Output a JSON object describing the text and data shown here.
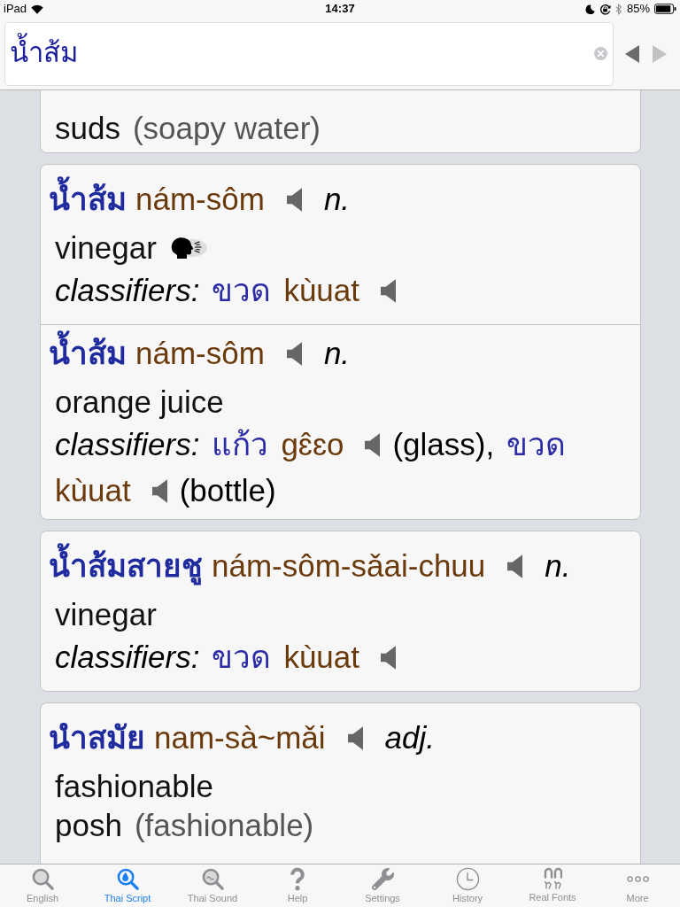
{
  "status_bar": {
    "carrier": "iPad",
    "time": "14:37",
    "battery": "85%"
  },
  "search": {
    "value": "น้ำส้ม",
    "nav": [
      {
        "kind": "back",
        "disabled": false
      },
      {
        "kind": "forward",
        "disabled": true
      }
    ]
  },
  "results": [
    {
      "top_cut": true,
      "bottom_cut": false,
      "entries": [
        {
          "definitions": [
            {
              "text": "suds",
              "note": "(soapy water)",
              "voice": false
            }
          ]
        }
      ]
    },
    {
      "top_cut": false,
      "bottom_cut": false,
      "entries": [
        {
          "thai": "น้ำส้ม",
          "roman": "nám-sôm",
          "pos": "n.",
          "definitions": [
            {
              "text": "vinegar",
              "voice": true
            }
          ],
          "classifier_label": "classifiers:",
          "classifiers": [
            {
              "thai": "ขวด",
              "roman": "kùuat"
            }
          ]
        },
        {
          "thai": "น้ำส้ม",
          "roman": "nám-sôm",
          "pos": "n.",
          "definitions": [
            {
              "text": "orange juice",
              "voice": false
            }
          ],
          "classifier_label": "classifiers:",
          "classifiers": [
            {
              "thai": "แก้ว",
              "roman": "gɛ̂ɛo",
              "note": "(glass),"
            },
            {
              "thai": "ขวด",
              "roman": "kùuat",
              "note": "(bottle)"
            }
          ]
        }
      ]
    },
    {
      "top_cut": false,
      "bottom_cut": false,
      "entries": [
        {
          "thai": "น้ำส้มสายชู",
          "roman": "nám-sôm-sǎai-chuu",
          "pos": "n.",
          "definitions": [
            {
              "text": "vinegar",
              "voice": false
            }
          ],
          "classifier_label": "classifiers:",
          "classifiers": [
            {
              "thai": "ขวด",
              "roman": "kùuat"
            }
          ]
        }
      ]
    },
    {
      "top_cut": false,
      "bottom_cut": true,
      "entries": [
        {
          "thai": "นำสมัย",
          "roman": "nam-sà~mǎi",
          "pos": "adj.",
          "definitions": [
            {
              "text": "fashionable",
              "voice": false
            },
            {
              "text": "posh",
              "note": "(fashionable)",
              "voice": false
            }
          ]
        }
      ]
    }
  ],
  "tabs": [
    {
      "label": "English",
      "kind": "english",
      "selected": false
    },
    {
      "label": "Thai Script",
      "kind": "script",
      "selected": true
    },
    {
      "label": "Thai Sound",
      "kind": "sound",
      "selected": false
    },
    {
      "label": "Help",
      "kind": "help",
      "selected": false
    },
    {
      "label": "Settings",
      "kind": "settings",
      "selected": false
    },
    {
      "label": "History",
      "kind": "history",
      "selected": false
    },
    {
      "label": "Real Fonts",
      "kind": "fonts",
      "selected": false
    },
    {
      "label": "More",
      "kind": "more",
      "selected": false
    }
  ]
}
